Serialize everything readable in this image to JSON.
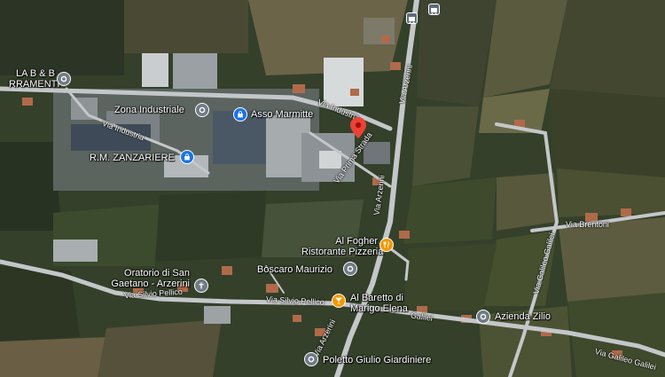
{
  "map": {
    "road_labels": {
      "via_industria_1": "Via Industria",
      "via_industria_2": "Via Industria",
      "via_prima_strada": "Via Prima Strada",
      "via_arzerini_top": "Via Arzerini",
      "via_arzerini_mid": "Via Arzerini",
      "via_arzerini_bottom": "Via Arzerini",
      "via_silvio_pellico_1": "Via Silvio Pellico",
      "via_silvio_pellico_2": "Via Silvio Pellico",
      "via_brentoni": "Via Brentoni",
      "via_galileo_galilei_1": "Via Galileo Galilei",
      "via_galileo_galilei_2": "Via Galileo Galilei",
      "via_galilei": "Galilei"
    },
    "places": [
      {
        "key": "lab",
        "lines": [
          "LA B & B",
          "RRAMENTI"
        ],
        "icon": "place-icon",
        "color": "#707b85"
      },
      {
        "key": "zona",
        "lines": [
          "Zona Industriale"
        ],
        "icon": "place-icon",
        "color": "#707b85"
      },
      {
        "key": "asso",
        "lines": [
          "Asso Marmitte"
        ],
        "icon": "shopping-bag-icon",
        "color": "#1a73e8"
      },
      {
        "key": "rm",
        "lines": [
          "R.M. ZANZARIERE"
        ],
        "icon": "shopping-bag-icon",
        "color": "#1a73e8"
      },
      {
        "key": "fogher",
        "lines": [
          "Al Fogher",
          "Ristorante Pizzeria"
        ],
        "icon": "restaurant-icon",
        "color": "#f29900"
      },
      {
        "key": "boscaro",
        "lines": [
          "Boscaro Maurizio"
        ],
        "icon": "place-icon",
        "color": "#707b85"
      },
      {
        "key": "oratorio",
        "lines": [
          "Oratorio di San",
          "Gaetano - Arzerini"
        ],
        "icon": "church-icon",
        "color": "#707b85"
      },
      {
        "key": "baretto",
        "lines": [
          "Al Baretto di",
          "Marigo Elena"
        ],
        "icon": "bar-icon",
        "color": "#f29900"
      },
      {
        "key": "zilio",
        "lines": [
          "Azienda Zilio"
        ],
        "icon": "place-icon",
        "color": "#707b85"
      },
      {
        "key": "poletto",
        "lines": [
          "Poletto Giulio Giardiniere"
        ],
        "icon": "place-icon",
        "color": "#707b85"
      }
    ],
    "selected_pin": {
      "icon": "location-pin-icon",
      "color": "#ea4335"
    },
    "transit": {
      "icon": "bus-stop-icon"
    }
  }
}
